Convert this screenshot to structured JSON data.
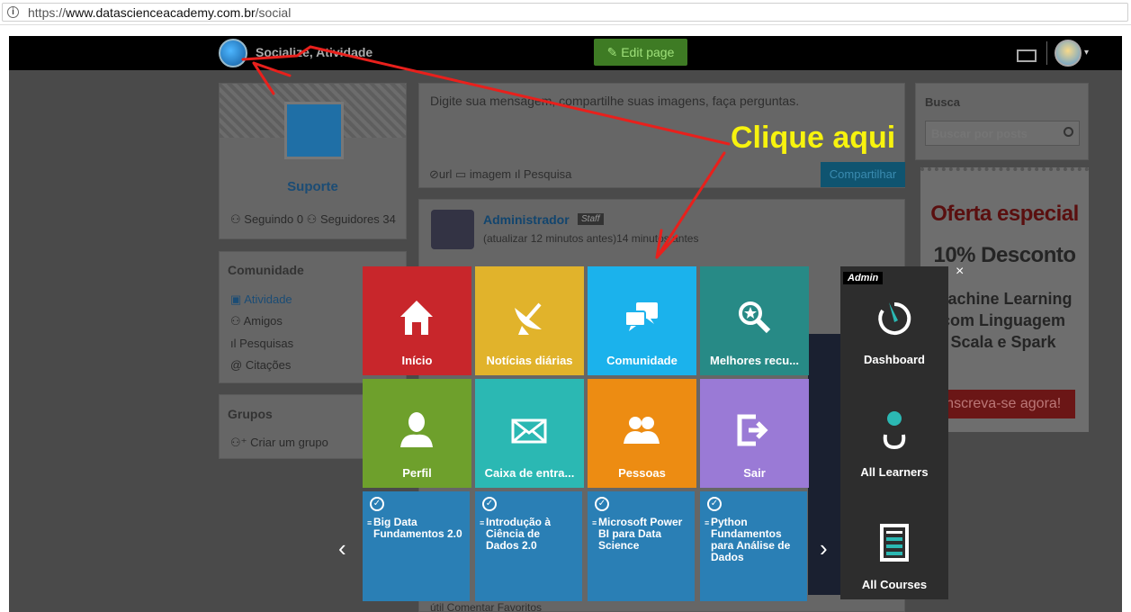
{
  "browser": {
    "url_prefix": "https://",
    "url_domain": "www.datascienceacademy.com.br",
    "url_path": "/social",
    "info_glyph": "i"
  },
  "nav": {
    "title": "Socialize, Atividade",
    "edit_button": "Edit page"
  },
  "profile": {
    "name": "Suporte",
    "following": "Seguindo 0",
    "followers": "Seguidores 34"
  },
  "community": {
    "heading": "Comunidade",
    "items": [
      "Atividade",
      "Amigos",
      "Pesquisas",
      "Citações"
    ]
  },
  "groups": {
    "heading": "Grupos",
    "create": "Criar um grupo"
  },
  "post": {
    "placeholder": "Digite sua mensagem, compartilhe suas imagens, faça perguntas.",
    "action_url": "url",
    "action_image": "imagem",
    "action_poll": "Pesquisa",
    "share_button": "Compartilhar"
  },
  "feed": {
    "author": "Administrador",
    "badge": "Staff",
    "time": "(atualizar 12 minutos antes)14 minutos antes",
    "footer": "útil  Comentar  Favoritos"
  },
  "search": {
    "label": "Busca",
    "placeholder": "Buscar por posts"
  },
  "ad": {
    "title": "Oferta especial",
    "discount": "10% Desconto",
    "course": "Machine Learning com Linguagem Scala e Spark",
    "button": "Inscreva-se agora!"
  },
  "annotation": {
    "text": "Clique aqui",
    "color": "#f7f30e",
    "arrow_color": "#e8201c"
  },
  "menu": {
    "tiles": [
      {
        "label": "Início",
        "color": "#c8262b",
        "icon": "home-icon"
      },
      {
        "label": "Notícias diárias",
        "color": "#e1b32b",
        "icon": "satellite-icon"
      },
      {
        "label": "Comunidade",
        "color": "#1bb2ec",
        "icon": "chat-icon"
      },
      {
        "label": "Melhores recu...",
        "color": "#278a86",
        "icon": "search-star-icon"
      },
      {
        "label": "Perfil",
        "color": "#6ea02c",
        "icon": "person-icon"
      },
      {
        "label": "Caixa de entra...",
        "color": "#2bb8b3",
        "icon": "mail-icon"
      },
      {
        "label": "Pessoas",
        "color": "#ed8c12",
        "icon": "people-icon"
      },
      {
        "label": "Sair",
        "color": "#9a7ad6",
        "icon": "logout-icon"
      }
    ],
    "courses": [
      {
        "title": "Big Data Fundamentos 2.0"
      },
      {
        "title": "Introdução à Ciência de Dados 2.0"
      },
      {
        "title": "Microsoft Power BI para Data Science"
      },
      {
        "title": "Python Fundamentos para Análise de Dados"
      }
    ],
    "admin_badge": "Admin",
    "admin": [
      {
        "label": "Dashboard",
        "icon": "dashboard-icon"
      },
      {
        "label": "All Learners",
        "icon": "learners-icon"
      },
      {
        "label": "All Courses",
        "icon": "courses-icon"
      }
    ],
    "close": "×",
    "prev": "‹",
    "next": "›"
  }
}
